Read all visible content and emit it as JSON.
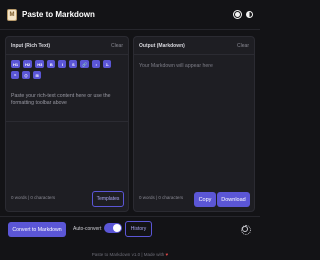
{
  "header": {
    "logo_glyph": "M",
    "title": "Paste to Markdown",
    "icons": [
      "sun-icon",
      "theme-toggle-icon"
    ]
  },
  "input_panel": {
    "title": "Input (Rich Text)",
    "clear_label": "Clear",
    "toolbar": [
      "H1",
      "H2",
      "H3",
      "B",
      "I",
      "S",
      "🔗",
      "•",
      "1.",
      "❝",
      "⟨⟩",
      "⊞"
    ],
    "placeholder": "Paste your rich-text content here or use the formatting toolbar above",
    "count": "0 words | 0 characters",
    "templates_label": "Templates"
  },
  "output_panel": {
    "title": "Output (Markdown)",
    "clear_label": "Clear",
    "placeholder": "Your Markdown will appear here",
    "count": "0 words | 0 characters",
    "copy_label": "Copy",
    "download_label": "Download"
  },
  "controls": {
    "convert_label": "Convert to Markdown",
    "auto_convert_label": "Auto-convert",
    "auto_convert_on": true,
    "history_label": "History"
  },
  "footer": {
    "text": "Paste to Markdown v1.0 | Made with",
    "heart": "♥"
  },
  "colors": {
    "accent": "#5b56d6",
    "background": "#131316",
    "panel": "#1e1e23"
  }
}
